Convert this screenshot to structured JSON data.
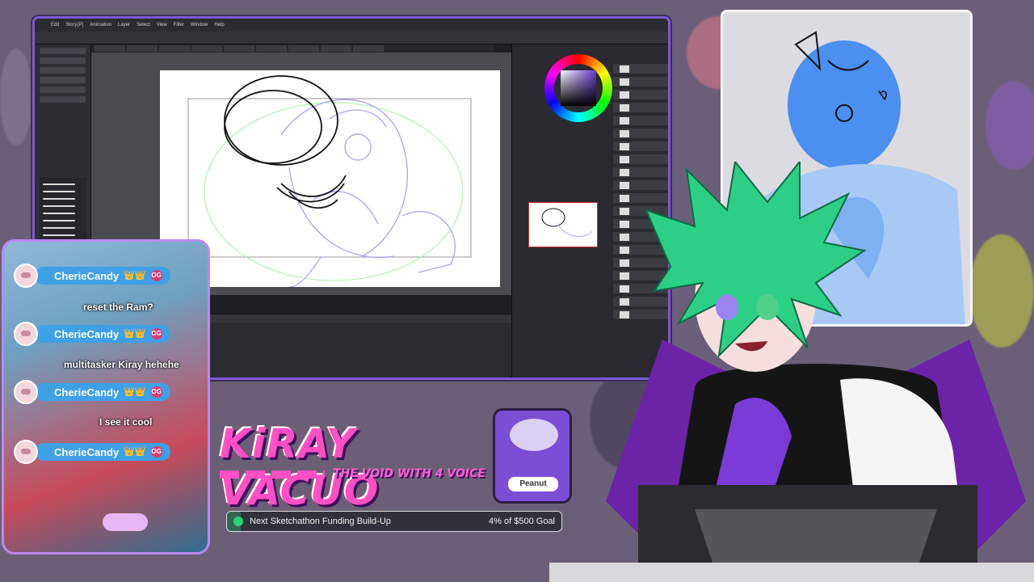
{
  "app": {
    "menu": [
      "Edit",
      "Story(P)",
      "Animation",
      "Layer",
      "Select",
      "View",
      "Filter",
      "Window",
      "Help"
    ]
  },
  "chat": {
    "messages": [
      {
        "user": "CherieCandy",
        "badges": "👑👑",
        "og": "OG",
        "text": "reset the Ram?"
      },
      {
        "user": "CherieCandy",
        "badges": "👑👑",
        "og": "OG",
        "text": "multitasker Kiray hehehe"
      },
      {
        "user": "CherieCandy",
        "badges": "👑👑",
        "og": "OG",
        "text": "I see it cool"
      },
      {
        "user": "CherieCandy",
        "badges": "👑👑",
        "og": "OG",
        "text": ""
      }
    ]
  },
  "branding": {
    "title": "KiRAY VACUO",
    "subtitle": "THE VOID WITH 4 VOICE",
    "car_label": "Peanut"
  },
  "goal": {
    "title": "Next Sketchathon Funding Build-Up",
    "amount_text": "4% of $500 Goal",
    "progress_percent": 4
  },
  "colors": {
    "accent": "#7c58d8",
    "pink": "#ff4fc4",
    "chat_pill": "#3fa0e6",
    "goal_fill": "#2fd07a"
  }
}
